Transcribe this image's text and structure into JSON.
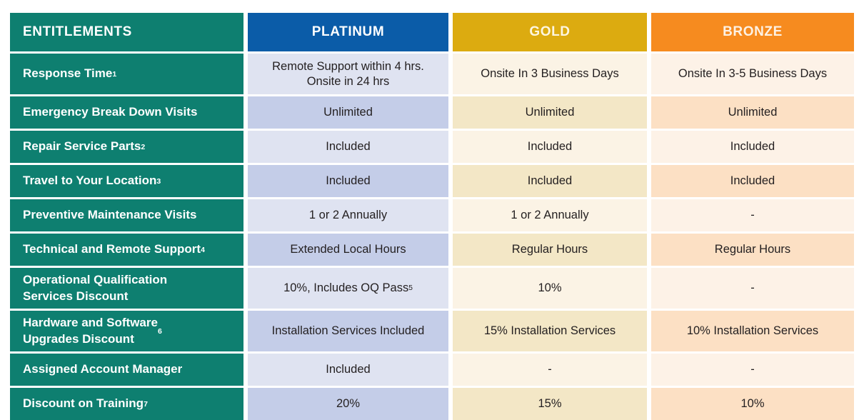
{
  "table": {
    "columns": [
      {
        "key": "entitlements",
        "label": "ENTITLEMENTS",
        "header_bg": "#0e7f70",
        "header_fg": "#ffffff"
      },
      {
        "key": "platinum",
        "label": "PLATINUM",
        "header_bg": "#0b5ca8",
        "header_fg": "#ffffff"
      },
      {
        "key": "gold",
        "label": "GOLD",
        "header_bg": "#dcab10",
        "header_fg": "#fdf6e0"
      },
      {
        "key": "bronze",
        "label": "BRONZE",
        "header_bg": "#f68b1f",
        "header_fg": "#fdf1e3"
      }
    ],
    "rows": [
      {
        "label": "Response Time",
        "label_sup": "1",
        "platinum": "Remote Support within 4 hrs.\nOnsite in 24 hrs",
        "gold": "Onsite In 3 Business Days",
        "bronze": "Onsite In 3-5 Business Days"
      },
      {
        "label": "Emergency Break Down Visits",
        "label_sup": "",
        "platinum": "Unlimited",
        "gold": "Unlimited",
        "bronze": "Unlimited"
      },
      {
        "label": "Repair Service Parts",
        "label_sup": "2",
        "platinum": "Included",
        "gold": "Included",
        "bronze": "Included"
      },
      {
        "label": "Travel to Your Location",
        "label_sup": "3",
        "platinum": "Included",
        "gold": "Included",
        "bronze": "Included"
      },
      {
        "label": "Preventive Maintenance Visits",
        "label_sup": "",
        "platinum": "1 or 2 Annually",
        "gold": "1 or 2 Annually",
        "bronze": "-"
      },
      {
        "label": "Technical and Remote Support",
        "label_sup": "4",
        "platinum": "Extended Local Hours",
        "gold": "Regular Hours",
        "bronze": "Regular Hours"
      },
      {
        "label": "Operational Qualification\nServices Discount",
        "label_sup": "",
        "platinum": "10%, Includes OQ Pass",
        "platinum_sup": "5",
        "gold": "10%",
        "bronze": "-"
      },
      {
        "label": "Hardware and Software\nUpgrades Discount",
        "label_sup": "6",
        "platinum": "Installation Services Included",
        "gold": "15% Installation Services",
        "bronze": "10% Installation Services"
      },
      {
        "label": "Assigned Account Manager",
        "label_sup": "",
        "platinum": "Included",
        "gold": "-",
        "bronze": "-"
      },
      {
        "label": "Discount on Training",
        "label_sup": "7",
        "platinum": "20%",
        "gold": "15%",
        "bronze": "10%"
      }
    ],
    "colors": {
      "teal": "#0e7f70",
      "platinum_blue": "#0b5ca8",
      "gold_yellow": "#dcab10",
      "bronze_orange": "#f68b1f",
      "platinum_light": "#dfe3f1",
      "platinum_dark": "#c4cde8",
      "gold_light": "#fbf3e5",
      "gold_dark": "#f3e7c6",
      "bronze_light": "#fdf2e7",
      "bronze_dark": "#fce0c4",
      "text_dark": "#231f20",
      "background": "#ffffff"
    }
  }
}
